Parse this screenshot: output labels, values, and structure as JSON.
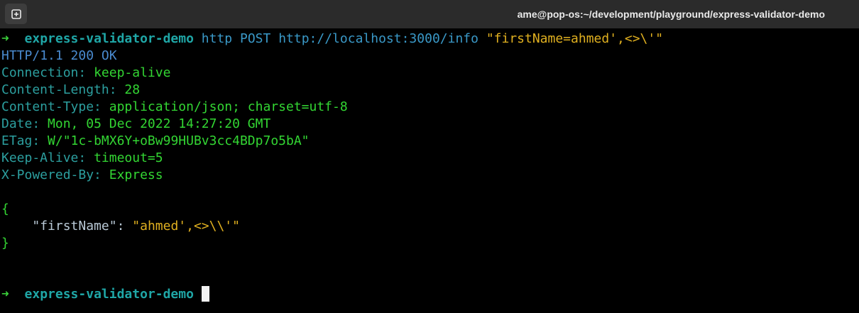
{
  "window": {
    "title": "ame@pop-os:~/development/playground/express-validator-demo"
  },
  "icons": {
    "new_tab": "new-tab-plus-icon",
    "prompt": "arrow-right-icon"
  },
  "terminal": {
    "prompt_arrow": "➜",
    "prompt_dir": "express-validator-demo",
    "command": {
      "program": "http",
      "method": "POST",
      "url": "http://localhost:3000/info",
      "argument": "\"firstName=ahmed',<>\\'\""
    },
    "response": {
      "protocol": "HTTP/",
      "version": "1.1",
      "status_code": "200",
      "status_text": "OK",
      "headers": [
        {
          "key": "Connection",
          "value": "keep-alive"
        },
        {
          "key": "Content-Length",
          "value": "28"
        },
        {
          "key": "Content-Type",
          "value": "application/json; charset=utf-8"
        },
        {
          "key": "Date",
          "value": "Mon, 05 Dec 2022 14:27:20 GMT"
        },
        {
          "key": "ETag",
          "value": "W/\"1c-bMX6Y+oBw99HUBv3cc4BDp7o5bA\""
        },
        {
          "key": "Keep-Alive",
          "value": "timeout=5"
        },
        {
          "key": "X-Powered-By",
          "value": "Express"
        }
      ],
      "body": {
        "open_brace": "{",
        "key": "\"firstName\"",
        "colon": ": ",
        "value": "\"ahmed',<>\\\\'\"",
        "close_brace": "}"
      }
    },
    "final_prompt_dir": "express-validator-demo"
  },
  "colors": {
    "background": "#000000",
    "titlebar": "#2b2b2b",
    "prompt_arrow": "#3bd13b",
    "prompt_dir": "#1fa6a6",
    "string": "#e0b020",
    "header_key": "#2c9f9f",
    "header_value": "#33d633"
  }
}
